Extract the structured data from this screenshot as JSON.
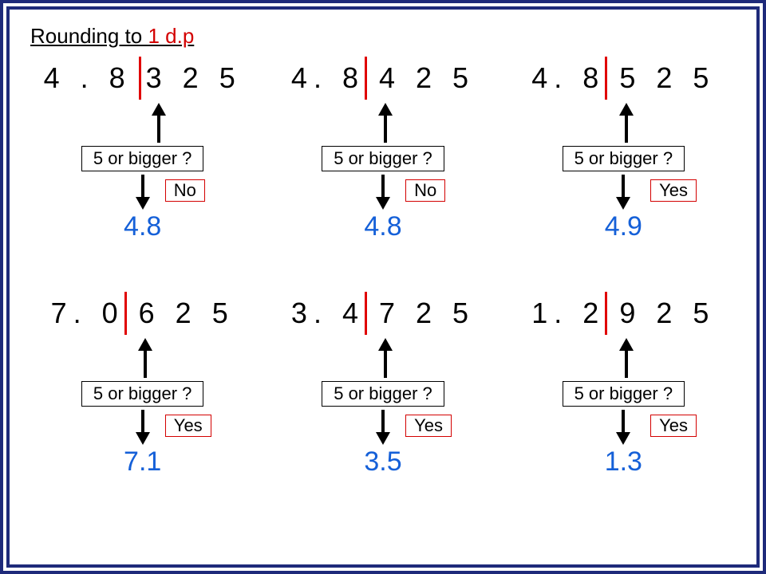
{
  "title": {
    "prefix": "Rounding to ",
    "dp": "1 d.p"
  },
  "question": "5 or bigger ?",
  "examples": [
    {
      "number": "4 . 8 3 2 5",
      "line_left_pct": 48,
      "arrow_align_pct": 54,
      "answer": "No",
      "ans_left_pct": 60,
      "result": "4.8"
    },
    {
      "number": "4. 8 4 2 5",
      "line_left_pct": 40,
      "arrow_align_pct": 48,
      "answer": "No",
      "ans_left_pct": 60,
      "result": "4.8"
    },
    {
      "number": "4. 8 5 2 5",
      "line_left_pct": 40,
      "arrow_align_pct": 48,
      "answer": "Yes",
      "ans_left_pct": 62,
      "result": "4.9"
    },
    {
      "number": "7. 0 6 2 5",
      "line_left_pct": 40,
      "arrow_align_pct": 48,
      "answer": "Yes",
      "ans_left_pct": 60,
      "result": "7.1"
    },
    {
      "number": "3. 4 7 2 5",
      "line_left_pct": 40,
      "arrow_align_pct": 48,
      "answer": "Yes",
      "ans_left_pct": 60,
      "result": "3.5"
    },
    {
      "number": "1. 2 9 2 5",
      "line_left_pct": 40,
      "arrow_align_pct": 48,
      "answer": "Yes",
      "ans_left_pct": 62,
      "result": "1.3"
    }
  ]
}
